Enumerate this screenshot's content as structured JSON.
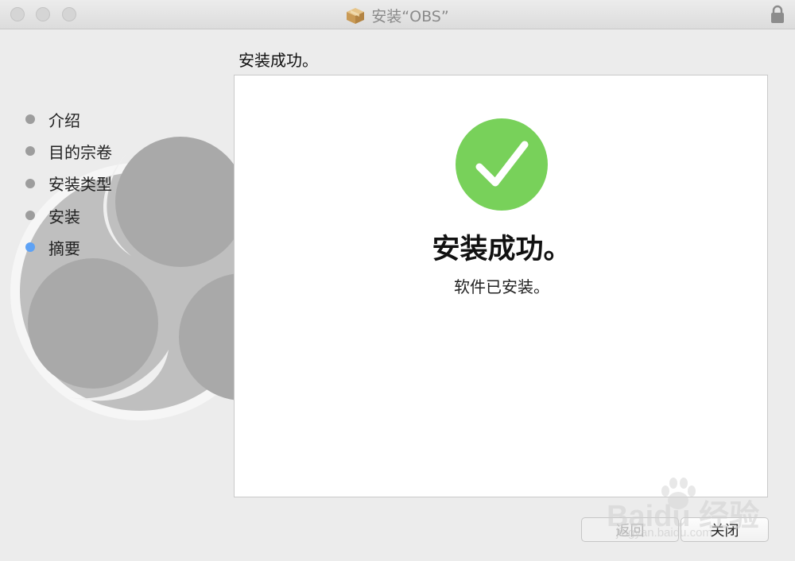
{
  "window": {
    "title": "安装“OBS”",
    "package_icon": "package-icon",
    "lock_icon": "lock-icon"
  },
  "sidebar": {
    "steps": [
      {
        "label": "介绍",
        "active": false
      },
      {
        "label": "目的宗卷",
        "active": false
      },
      {
        "label": "安装类型",
        "active": false
      },
      {
        "label": "安装",
        "active": false
      },
      {
        "label": "摘要",
        "active": true
      }
    ]
  },
  "main": {
    "header": "安装成功。",
    "success_title": "安装成功。",
    "success_message": "软件已安装。",
    "icon": "checkmark-circle-icon"
  },
  "buttons": {
    "back_label": "返回",
    "close_label": "关闭"
  },
  "watermark": {
    "text": "Baidu 经验",
    "url": "jingyan.baidu.com"
  },
  "colors": {
    "success_green": "#78d15a",
    "active_step": "#5ea2f5",
    "inactive_step": "#9d9d9d"
  }
}
